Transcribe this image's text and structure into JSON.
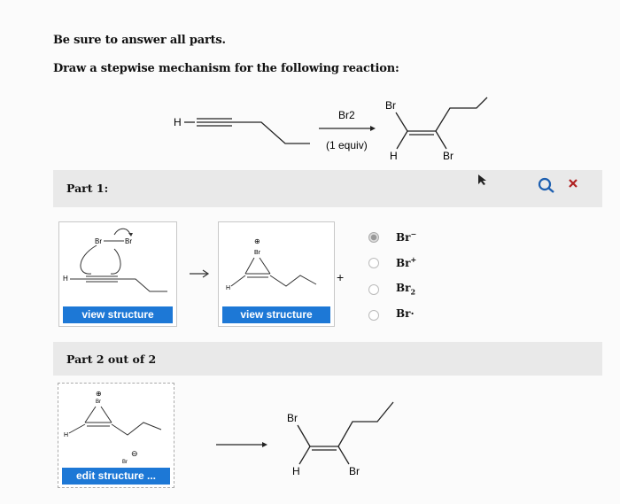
{
  "instructions": {
    "line1": "Be sure to answer all parts.",
    "line2": "Draw a stepwise mechanism for the following reaction:"
  },
  "reaction": {
    "reactant_h": "H",
    "reagent": "Br2",
    "reagent_note": "(1 equiv)",
    "product_br_top": "Br",
    "product_h": "H",
    "product_br_bottom": "Br"
  },
  "part1": {
    "label": "Part 1:",
    "struct1": {
      "br_left": "Br",
      "br_right": "Br",
      "h": "H"
    },
    "struct2": {
      "charge": "⊕",
      "br": "Br",
      "h": "H"
    },
    "plus": "+",
    "view_button_1": "view structure",
    "view_button_2": "view structure",
    "options": [
      {
        "label": "Br",
        "sup": "−",
        "selected": true
      },
      {
        "label": "Br",
        "sup": "+",
        "selected": false
      },
      {
        "label": "Br",
        "sub": "2",
        "selected": false
      },
      {
        "label": "Br·",
        "selected": false
      }
    ]
  },
  "part2": {
    "label": "Part 2 out of 2",
    "struct": {
      "charge_top": "⊕",
      "br_top": "Br",
      "h": "H",
      "br_ion": "Br",
      "charge_ion": "⊖"
    },
    "edit_button": "edit structure ...",
    "product": {
      "br_top": "Br",
      "h": "H",
      "br_bottom": "Br"
    }
  },
  "toolbar": {
    "magnifier_icon": "magnifier-icon",
    "close_icon": "close-icon",
    "cursor_icon": "cursor-icon"
  }
}
